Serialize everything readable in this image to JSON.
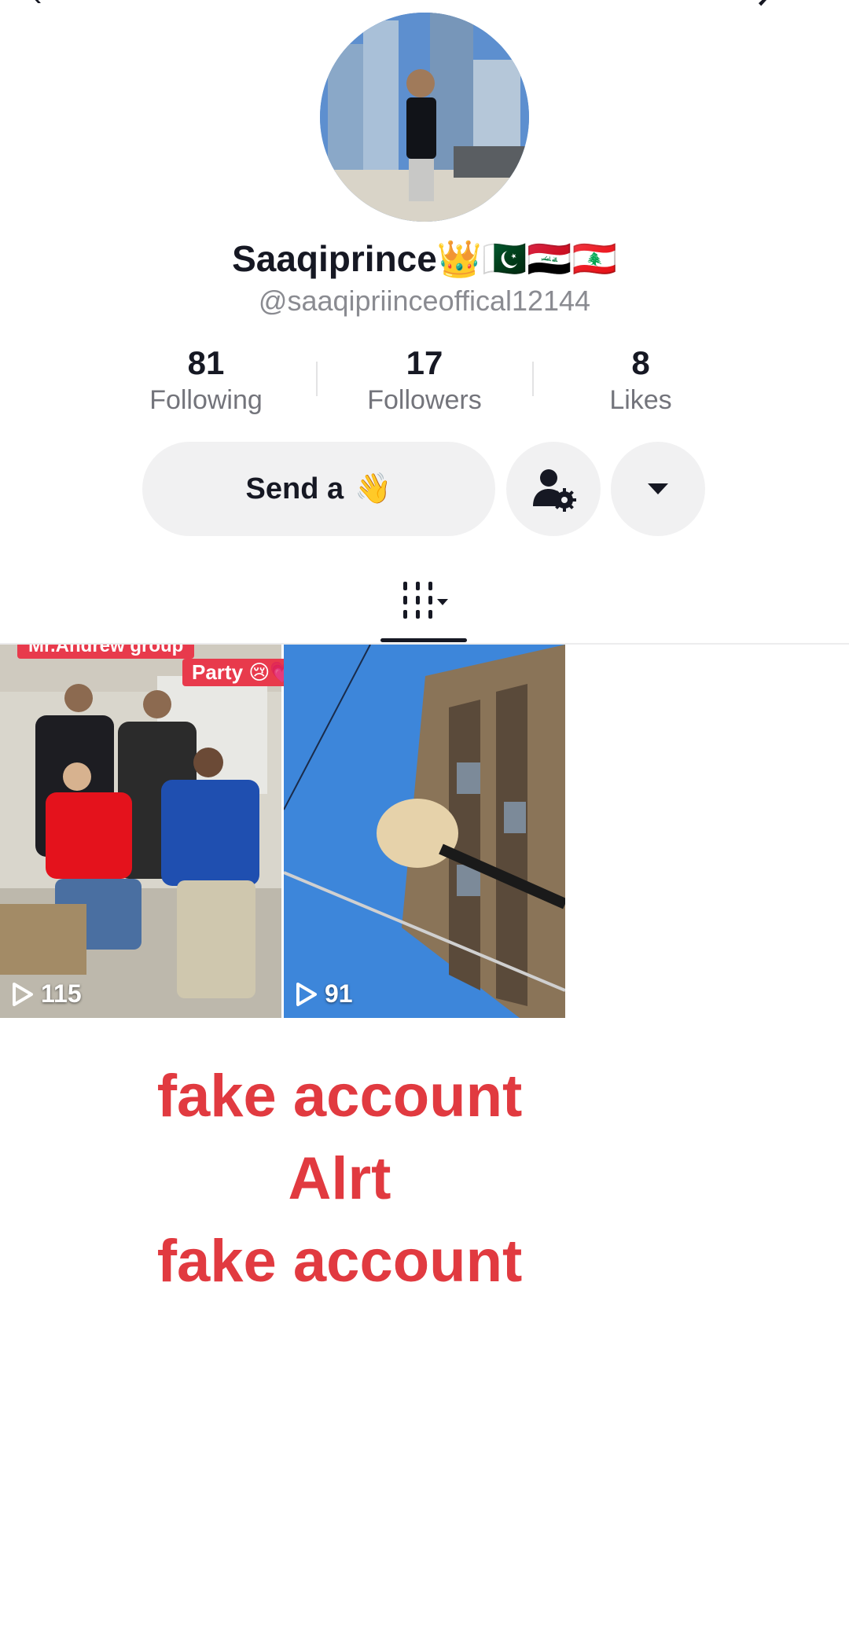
{
  "profile": {
    "display_name": "Saaqiprince👑🇵🇰🇮🇶🇱🇧",
    "username": "@saaqipriinceoffical12144"
  },
  "stats": [
    {
      "number": "81",
      "label": "Following"
    },
    {
      "number": "17",
      "label": "Followers"
    },
    {
      "number": "8",
      "label": "Likes"
    }
  ],
  "actions": {
    "send_label": "Send a",
    "send_emoji": "👋",
    "settings_icon": "person-gear-icon",
    "more_icon": "caret-down-icon"
  },
  "tabs": {
    "active_icon": "grid-icon"
  },
  "videos": [
    {
      "views": "115",
      "caption_top": "Mr.Andrew group",
      "caption_tag": "Party 😢💗"
    },
    {
      "views": "91"
    }
  ],
  "overlay_text": {
    "line1": "fake account",
    "line2": "Alrt",
    "line3": "fake account"
  },
  "colors": {
    "alert_red": "#e13a40",
    "button_gray": "#f1f1f2",
    "caption_red": "#e83a4c"
  }
}
